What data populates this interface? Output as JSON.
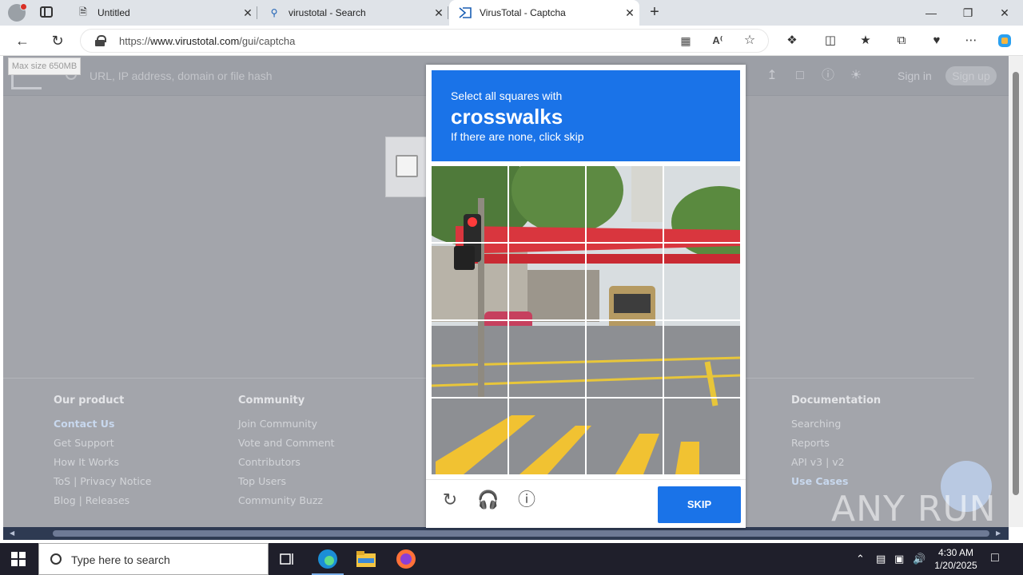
{
  "browser": {
    "tabs": [
      {
        "label": "Untitled",
        "icon": "document-icon"
      },
      {
        "label": "virustotal - Search",
        "icon": "search-icon"
      },
      {
        "label": "VirusTotal - Captcha",
        "icon": "virustotal-icon",
        "active": true
      }
    ],
    "url_prefix": "https://",
    "url_host": "www.virustotal.com",
    "url_path": "/gui/captcha"
  },
  "virustotal": {
    "search_placeholder": "URL, IP address, domain or file hash",
    "max_size_tip": "Max size 650MB",
    "sign_in": "Sign in",
    "sign_up": "Sign up",
    "footer": {
      "our_product": {
        "title": "Our product",
        "links": [
          "Contact Us",
          "Get Support",
          "How It Works",
          "ToS | Privacy Notice",
          "Blog | Releases"
        ]
      },
      "community": {
        "title": "Community",
        "links": [
          "Join Community",
          "Vote and Comment",
          "Contributors",
          "Top Users",
          "Community Buzz"
        ]
      },
      "documentation": {
        "title": "Documentation",
        "links": [
          "Searching",
          "Reports",
          "API v3 | v2",
          "Use Cases"
        ]
      }
    }
  },
  "captcha": {
    "instruction": "Select all squares with",
    "target": "crosswalks",
    "hint": "If there are none, click skip",
    "skip_label": "SKIP",
    "grid_size": 4,
    "icons": [
      "reload-icon",
      "audio-icon",
      "info-icon"
    ]
  },
  "watermark": "ANY RUN",
  "taskbar": {
    "search_placeholder": "Type here to search",
    "time": "4:30 AM",
    "date": "1/20/2025"
  },
  "colors": {
    "captcha_blue": "#1a73e8",
    "overlay_gray": "#a3a5ab",
    "taskbar": "#1f1f2b"
  }
}
